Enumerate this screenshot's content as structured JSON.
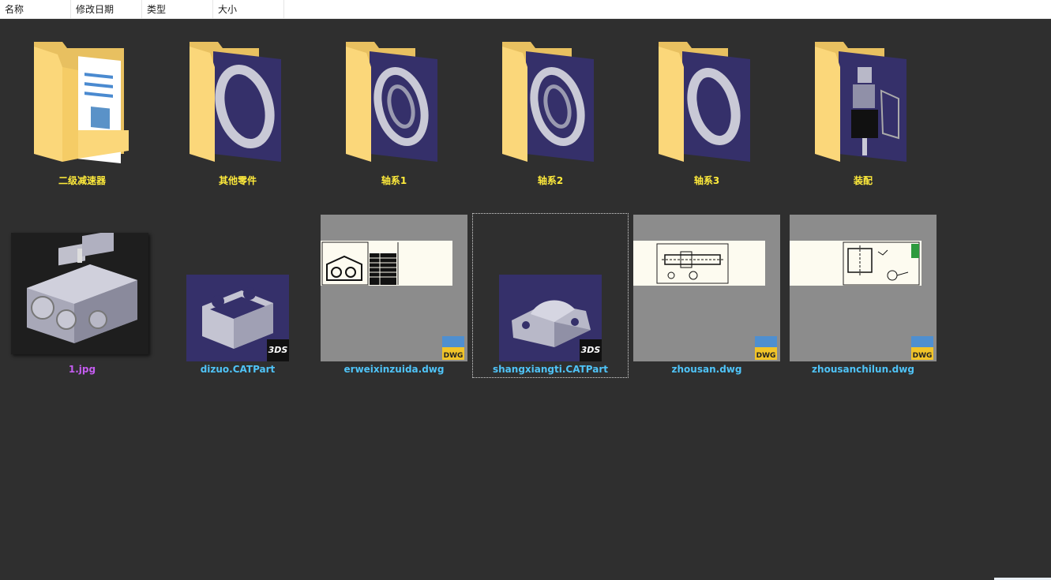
{
  "columns": [
    {
      "label": "名称"
    },
    {
      "label": "修改日期"
    },
    {
      "label": "类型"
    },
    {
      "label": "大小"
    }
  ],
  "sort_indicator": "^",
  "folders": [
    {
      "name": "二级减速器"
    },
    {
      "name": "其他零件"
    },
    {
      "name": "轴系1"
    },
    {
      "name": "轴系2"
    },
    {
      "name": "轴系3"
    },
    {
      "name": "装配"
    }
  ],
  "files": [
    {
      "name": "1.jpg",
      "type": "jpg"
    },
    {
      "name": "dizuo.CATPart",
      "type": "catpart"
    },
    {
      "name": "erweixinzuida.dwg",
      "type": "dwg"
    },
    {
      "name": "shangxiangti.CATPart",
      "type": "catpart",
      "selected": true
    },
    {
      "name": "zhousan.dwg",
      "type": "dwg"
    },
    {
      "name": "zhousanchilun.dwg",
      "type": "dwg"
    }
  ],
  "badges": {
    "catpart": "3DS",
    "dwg": "DWG"
  },
  "colors": {
    "background": "#2f2f2f",
    "folder_label": "#ffeb3b",
    "file_label": "#4fc3f7",
    "jpg_label": "#c45cf0"
  }
}
